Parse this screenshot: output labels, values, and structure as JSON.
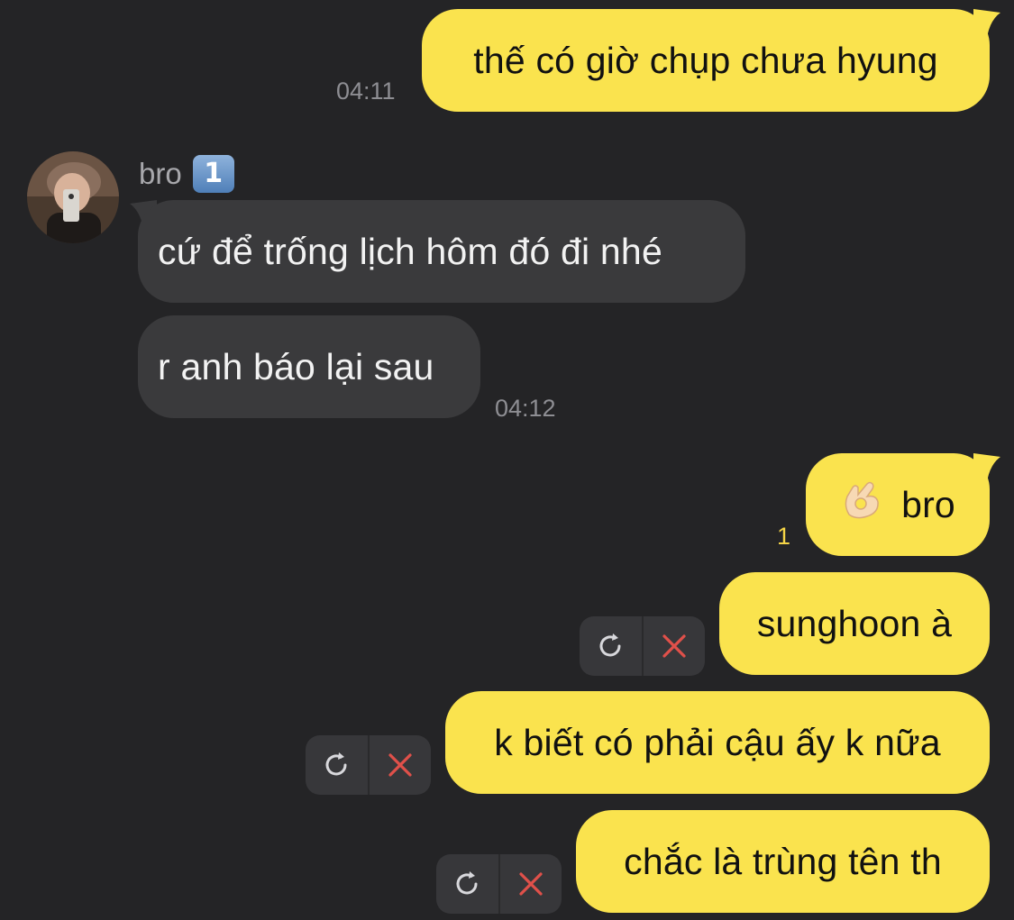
{
  "conversation": {
    "contact_name": "bro",
    "contact_badge": "1",
    "messages": [
      {
        "id": "m1",
        "direction": "out",
        "text": "thế có giờ chụp chưa hyung",
        "time": "04:11"
      },
      {
        "id": "m2",
        "direction": "in",
        "text": "cứ để trống lịch hôm đó đi nhé"
      },
      {
        "id": "m3",
        "direction": "in",
        "text": "r anh báo lại sau",
        "time": "04:12"
      },
      {
        "id": "m4",
        "direction": "out",
        "emoji": "ok-hand",
        "text": "bro",
        "unread_count": "1"
      },
      {
        "id": "m5",
        "direction": "out",
        "text": "sunghoon à",
        "status": "failed"
      },
      {
        "id": "m6",
        "direction": "out",
        "text": "k biết có phải cậu ấy k nữa",
        "status": "failed"
      },
      {
        "id": "m7",
        "direction": "out",
        "text": "chắc là trùng tên th",
        "status": "failed"
      }
    ]
  },
  "colors": {
    "background": "#242426",
    "outgoing_bubble": "#fae34e",
    "incoming_bubble": "#3a3a3c",
    "unread": "#f5d547",
    "delete_x": "#e0504a"
  },
  "icons": {
    "retry": "retry-icon",
    "delete": "delete-icon",
    "emoji": "ok-hand-emoji"
  }
}
